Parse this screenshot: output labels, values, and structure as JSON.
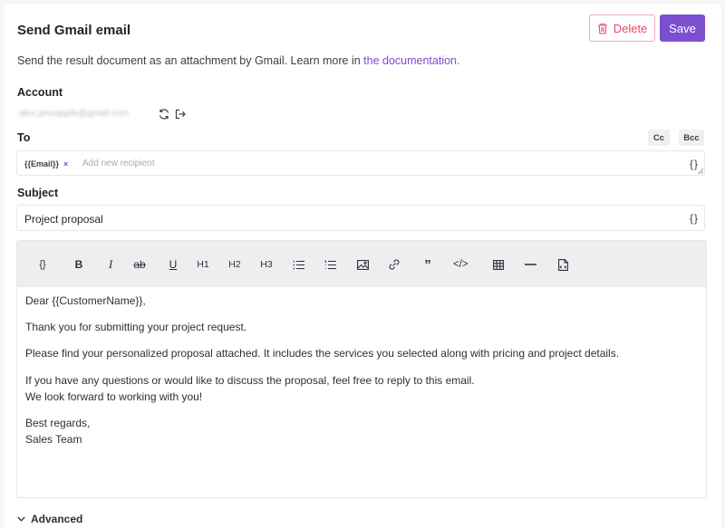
{
  "header": {
    "title": "Send Gmail email",
    "delete_label": "Delete",
    "save_label": "Save"
  },
  "description": {
    "text": "Send the result document as an attachment by Gmail. Learn more in ",
    "link": "the documentation."
  },
  "account": {
    "label": "Account",
    "email": "alex.pmsappfe@gmail.com"
  },
  "to": {
    "label": "To",
    "cc_label": "Cc",
    "bcc_label": "Bcc",
    "tag": "{{Email}}",
    "tag_remove": "×",
    "placeholder": "Add new recipient",
    "variable_icon": "{}"
  },
  "subject": {
    "label": "Subject",
    "value": "Project proposal",
    "variable_icon": "{}"
  },
  "toolbar": {
    "items": [
      {
        "name": "variable-icon",
        "glyph": "{}"
      },
      {
        "name": "bold-icon",
        "glyph": "B"
      },
      {
        "name": "italic-icon",
        "glyph": "I"
      },
      {
        "name": "strikethrough-icon",
        "glyph": "ab"
      },
      {
        "name": "underline-icon",
        "glyph": "U"
      },
      {
        "name": "heading1-icon",
        "glyph": "H1"
      },
      {
        "name": "heading2-icon",
        "glyph": "H2"
      },
      {
        "name": "heading3-icon",
        "glyph": "H3"
      },
      {
        "name": "bullet-list-icon",
        "glyph": ""
      },
      {
        "name": "ordered-list-icon",
        "glyph": ""
      },
      {
        "name": "image-icon",
        "glyph": ""
      },
      {
        "name": "link-icon",
        "glyph": ""
      },
      {
        "name": "quote-icon",
        "glyph": "”"
      },
      {
        "name": "code-icon",
        "glyph": "</>"
      },
      {
        "name": "table-icon",
        "glyph": ""
      },
      {
        "name": "horizontal-rule-icon",
        "glyph": "—"
      },
      {
        "name": "page-break-icon",
        "glyph": ""
      }
    ]
  },
  "body": {
    "lines": [
      "Dear {{CustomerName}},",
      "Thank you for submitting your project request.",
      "Please find your personalized proposal attached. It includes the services you selected along with pricing and project details.",
      "If you have any questions or would like to discuss the proposal, feel free to reply to this email.",
      "We look forward to working with you!",
      "Best regards,",
      "Sales Team"
    ]
  },
  "advanced": {
    "label": "Advanced"
  },
  "colors": {
    "accent": "#7b4fd0",
    "danger": "#e24b68"
  }
}
